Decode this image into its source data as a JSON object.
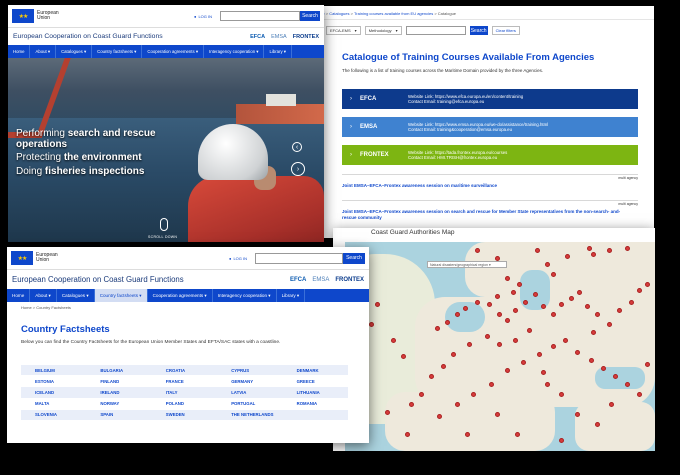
{
  "hero": {
    "eu_label": "European Union",
    "login": "LOG IN",
    "search_button": "Search",
    "site_title": "European Cooperation on Coast Guard Functions",
    "logos": [
      "EFCA",
      "EMSA",
      "FRONTEX"
    ],
    "nav": [
      "Home",
      "About ▾",
      "Catalogues ▾",
      "Country factsheets ▾",
      "Cooperation agreements ▾",
      "Interagency cooperation ▾",
      "Library ▾"
    ],
    "lines": [
      {
        "normal": "Performing ",
        "bold": "search and rescue operations"
      },
      {
        "normal": "Protecting ",
        "bold": "the environment"
      },
      {
        "normal": "Doing ",
        "bold": "fisheries inspections"
      }
    ],
    "scroll_down": "SCROLL DOWN",
    "prev_icon": "‹",
    "next_icon": "›"
  },
  "catalogue": {
    "breadcrumb": [
      "Home",
      "Catalogues",
      "Training courses available from EU agencies",
      "Catalogue"
    ],
    "filter_agency": "EFCA-EMS",
    "filter_methodology": "Methodology",
    "search_button": "Search",
    "clear_button": "Clear filters",
    "title": "Catalogue of Training Courses Available From Agencies",
    "intro": "The following is a list of training courses across the Maritime Domain provided by the three Agencies.",
    "agencies": [
      {
        "name": "EFCA",
        "website": "Website Link: https://www.efca.europa.eu/en/content/training",
        "email": "Contact Email: training@efca.europa.eu",
        "color": "#0d3a8c"
      },
      {
        "name": "EMSA",
        "website": "Website Link: https://www.emsa.europa.eu/we-do/assistance/training.html",
        "email": "Contact Email: training&cooperation@emsa.europa.eu",
        "color": "#3f82d0"
      },
      {
        "name": "FRONTEX",
        "website": "Website Link: https://tada.frontex.europa.eu/courses",
        "email": "Contact Email: HMI.TRISH@frontex.europa.eu",
        "color": "#7db512"
      }
    ],
    "courses": [
      {
        "title": "Joint EMSA–EFCA–Frontex awareness session on maritime surveillance",
        "tag": "multi agency"
      },
      {
        "title": "Joint EMSA–EFCA–Frontex awareness session on search and rescue for Member State representatives from the non-search- and-rescue community",
        "tag": "multi agency"
      }
    ]
  },
  "map": {
    "title": "Coast Guard Authorities Map",
    "search_placeholder": "Natural disasters/geographical region ▾"
  },
  "factsheets": {
    "eu_label": "European Union",
    "login": "LOG IN",
    "search_button": "Search",
    "site_title": "European Cooperation on Coast Guard Functions",
    "logos": [
      "EFCA",
      "EMSA",
      "FRONTEX"
    ],
    "nav": [
      "Home",
      "About ▾",
      "Catalogues ▾",
      "Country factsheets ▾",
      "Cooperation agreements ▾",
      "Interagency cooperation ▾",
      "Library ▾"
    ],
    "breadcrumb": "Home  >  Country Factsheets",
    "title": "Country Factsheets",
    "intro": "Below you can find the Country Factsheets for the European Union Member States and EFTA/SAC states with a coastline.",
    "countries": [
      "BELGIUM",
      "BULGARIA",
      "CROATIA",
      "CYPRUS",
      "DENMARK",
      "ESTONIA",
      "FINLAND",
      "FRANCE",
      "GERMANY",
      "GREECE",
      "ICELAND",
      "IRELAND",
      "ITALY",
      "LATVIA",
      "LITHUANIA",
      "MALTA",
      "NORWAY",
      "POLAND",
      "PORTUGAL",
      "ROMANIA",
      "SLOVENIA",
      "SPAIN",
      "SWEDEN",
      "THE NETHERLANDS",
      ""
    ]
  },
  "colors": {
    "brand_blue": "#0e47cb",
    "map_pin": "#d63b3b"
  }
}
